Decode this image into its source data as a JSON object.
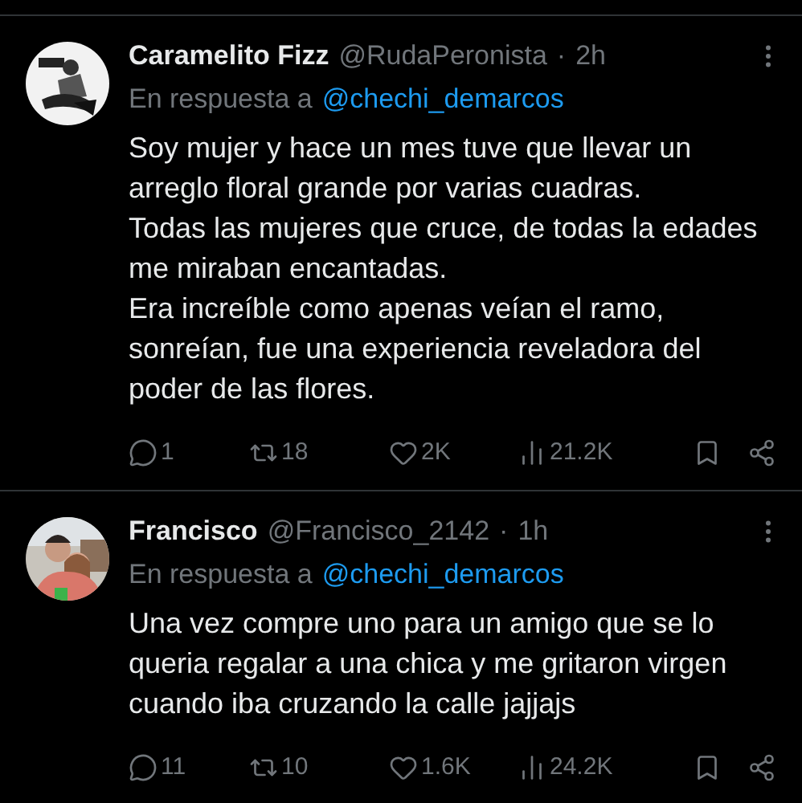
{
  "tweets": [
    {
      "name": "Caramelito Fizz",
      "handle": "@RudaPeronista",
      "separator": "·",
      "time": "2h",
      "reply_prefix": "En respuesta a",
      "reply_to": "@chechi_demarcos",
      "paragraphs": [
        "Soy mujer y hace un mes tuve que llevar un arreglo floral grande por varias cuadras.",
        "Todas las mujeres que cruce, de todas la edades me miraban encantadas.",
        "Era increíble como apenas veían el ramo, sonreían, fue una experiencia reveladora del poder de las flores."
      ],
      "avatar": {
        "kind": "drawing"
      },
      "replies": "1",
      "reposts": "18",
      "likes": "2K",
      "views": "21.2K"
    },
    {
      "name": "Francisco",
      "handle": "@Francisco_2142",
      "separator": "·",
      "time": "1h",
      "reply_prefix": "En respuesta a",
      "reply_to": "@chechi_demarcos",
      "paragraphs": [
        "Una vez compre uno para un amigo que se lo queria regalar a una chica y me gritaron virgen cuando iba cruzando la calle jajjajs"
      ],
      "avatar": {
        "kind": "picture"
      },
      "replies": "11",
      "reposts": "10",
      "likes": "1.6K",
      "views": "24.2K"
    }
  ]
}
